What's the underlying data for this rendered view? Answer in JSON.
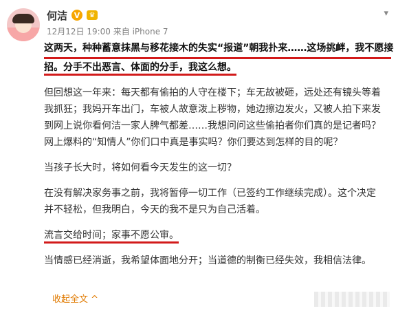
{
  "header": {
    "name": "何洁",
    "meta": "12月12日 19:00 来自 iPhone 7",
    "badge_v": "V"
  },
  "icons": {
    "chevron": "chevron-down-icon",
    "verified": "verified-badge-icon",
    "crown": "crown-icon"
  },
  "colors": {
    "underline": "#d21a1a",
    "link": "#e07a00",
    "badge": "#f7a600"
  },
  "post": {
    "p1": [
      "这两天，种种蓄意抹黑与移花接木的失实“报道”朝我扑来……这场挑衅，我不愿接",
      "招。分手不出恶言、体面的分手，我这么想。"
    ],
    "p2": [
      "但回想这一年来：每天都有偷拍的人守在楼下；车无故被砸，远处还有镜头等着",
      "我抓狂；我妈开车出门，车被人故意泼上秽物，她边擦边发火，又被人拍下来发",
      "到网上说你看何洁一家人脾气都差……我想问问这些偷拍者你们真的是记者吗？",
      "网上爆料的“知情人”你们口中真是事实吗？你们要达到怎样的目的呢？"
    ],
    "p3": "当孩子长大时，将如何看今天发生的这一切？",
    "p4": [
      "在没有解决家务事之前，我将暂停一切工作（已签约工作继续完成）。这个决定",
      "并不轻松，但我明白，今天的我不是只为自己活着。"
    ],
    "p5": "流言交给时间；家事不愿公审。",
    "p6": "当情感已经消逝，我希望体面地分开；当道德的制衡已经失效，我相信法律。",
    "collapse": "收起全文 ^"
  }
}
